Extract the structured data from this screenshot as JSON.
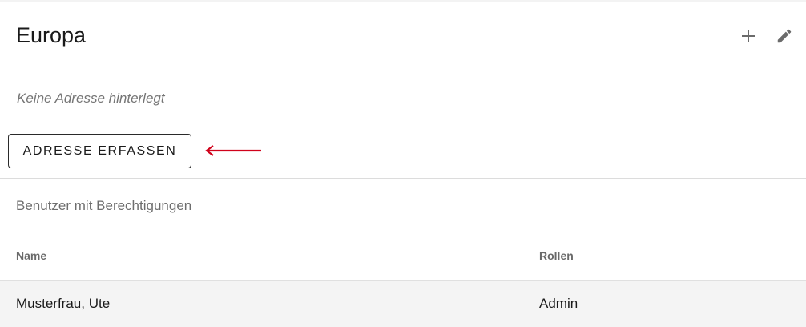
{
  "header": {
    "title": "Europa",
    "add_icon": "plus-icon",
    "edit_icon": "pencil-icon"
  },
  "address": {
    "empty_text": "Keine Adresse hinterlegt",
    "button_label": "ADRESSE ERFASSEN",
    "annotation_arrow_color": "#d0021b"
  },
  "permissions": {
    "section_title": "Benutzer mit Berechtigungen",
    "columns": [
      "Name",
      "Rollen"
    ],
    "rows": [
      {
        "name": "Musterfrau, Ute",
        "roles": "Admin"
      }
    ]
  }
}
